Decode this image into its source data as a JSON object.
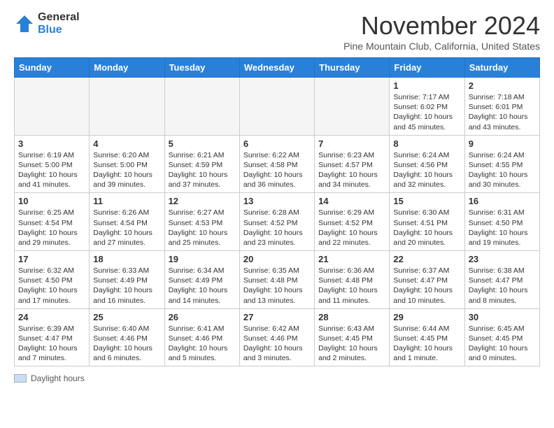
{
  "logo": {
    "general": "General",
    "blue": "Blue"
  },
  "title": "November 2024",
  "subtitle": "Pine Mountain Club, California, United States",
  "weekdays": [
    "Sunday",
    "Monday",
    "Tuesday",
    "Wednesday",
    "Thursday",
    "Friday",
    "Saturday"
  ],
  "legend_label": "Daylight hours",
  "weeks": [
    [
      {
        "day": "",
        "info": ""
      },
      {
        "day": "",
        "info": ""
      },
      {
        "day": "",
        "info": ""
      },
      {
        "day": "",
        "info": ""
      },
      {
        "day": "",
        "info": ""
      },
      {
        "day": "1",
        "info": "Sunrise: 7:17 AM\nSunset: 6:02 PM\nDaylight: 10 hours and 45 minutes."
      },
      {
        "day": "2",
        "info": "Sunrise: 7:18 AM\nSunset: 6:01 PM\nDaylight: 10 hours and 43 minutes."
      }
    ],
    [
      {
        "day": "3",
        "info": "Sunrise: 6:19 AM\nSunset: 5:00 PM\nDaylight: 10 hours and 41 minutes."
      },
      {
        "day": "4",
        "info": "Sunrise: 6:20 AM\nSunset: 5:00 PM\nDaylight: 10 hours and 39 minutes."
      },
      {
        "day": "5",
        "info": "Sunrise: 6:21 AM\nSunset: 4:59 PM\nDaylight: 10 hours and 37 minutes."
      },
      {
        "day": "6",
        "info": "Sunrise: 6:22 AM\nSunset: 4:58 PM\nDaylight: 10 hours and 36 minutes."
      },
      {
        "day": "7",
        "info": "Sunrise: 6:23 AM\nSunset: 4:57 PM\nDaylight: 10 hours and 34 minutes."
      },
      {
        "day": "8",
        "info": "Sunrise: 6:24 AM\nSunset: 4:56 PM\nDaylight: 10 hours and 32 minutes."
      },
      {
        "day": "9",
        "info": "Sunrise: 6:24 AM\nSunset: 4:55 PM\nDaylight: 10 hours and 30 minutes."
      }
    ],
    [
      {
        "day": "10",
        "info": "Sunrise: 6:25 AM\nSunset: 4:54 PM\nDaylight: 10 hours and 29 minutes."
      },
      {
        "day": "11",
        "info": "Sunrise: 6:26 AM\nSunset: 4:54 PM\nDaylight: 10 hours and 27 minutes."
      },
      {
        "day": "12",
        "info": "Sunrise: 6:27 AM\nSunset: 4:53 PM\nDaylight: 10 hours and 25 minutes."
      },
      {
        "day": "13",
        "info": "Sunrise: 6:28 AM\nSunset: 4:52 PM\nDaylight: 10 hours and 23 minutes."
      },
      {
        "day": "14",
        "info": "Sunrise: 6:29 AM\nSunset: 4:52 PM\nDaylight: 10 hours and 22 minutes."
      },
      {
        "day": "15",
        "info": "Sunrise: 6:30 AM\nSunset: 4:51 PM\nDaylight: 10 hours and 20 minutes."
      },
      {
        "day": "16",
        "info": "Sunrise: 6:31 AM\nSunset: 4:50 PM\nDaylight: 10 hours and 19 minutes."
      }
    ],
    [
      {
        "day": "17",
        "info": "Sunrise: 6:32 AM\nSunset: 4:50 PM\nDaylight: 10 hours and 17 minutes."
      },
      {
        "day": "18",
        "info": "Sunrise: 6:33 AM\nSunset: 4:49 PM\nDaylight: 10 hours and 16 minutes."
      },
      {
        "day": "19",
        "info": "Sunrise: 6:34 AM\nSunset: 4:49 PM\nDaylight: 10 hours and 14 minutes."
      },
      {
        "day": "20",
        "info": "Sunrise: 6:35 AM\nSunset: 4:48 PM\nDaylight: 10 hours and 13 minutes."
      },
      {
        "day": "21",
        "info": "Sunrise: 6:36 AM\nSunset: 4:48 PM\nDaylight: 10 hours and 11 minutes."
      },
      {
        "day": "22",
        "info": "Sunrise: 6:37 AM\nSunset: 4:47 PM\nDaylight: 10 hours and 10 minutes."
      },
      {
        "day": "23",
        "info": "Sunrise: 6:38 AM\nSunset: 4:47 PM\nDaylight: 10 hours and 8 minutes."
      }
    ],
    [
      {
        "day": "24",
        "info": "Sunrise: 6:39 AM\nSunset: 4:47 PM\nDaylight: 10 hours and 7 minutes."
      },
      {
        "day": "25",
        "info": "Sunrise: 6:40 AM\nSunset: 4:46 PM\nDaylight: 10 hours and 6 minutes."
      },
      {
        "day": "26",
        "info": "Sunrise: 6:41 AM\nSunset: 4:46 PM\nDaylight: 10 hours and 5 minutes."
      },
      {
        "day": "27",
        "info": "Sunrise: 6:42 AM\nSunset: 4:46 PM\nDaylight: 10 hours and 3 minutes."
      },
      {
        "day": "28",
        "info": "Sunrise: 6:43 AM\nSunset: 4:45 PM\nDaylight: 10 hours and 2 minutes."
      },
      {
        "day": "29",
        "info": "Sunrise: 6:44 AM\nSunset: 4:45 PM\nDaylight: 10 hours and 1 minute."
      },
      {
        "day": "30",
        "info": "Sunrise: 6:45 AM\nSunset: 4:45 PM\nDaylight: 10 hours and 0 minutes."
      }
    ]
  ]
}
